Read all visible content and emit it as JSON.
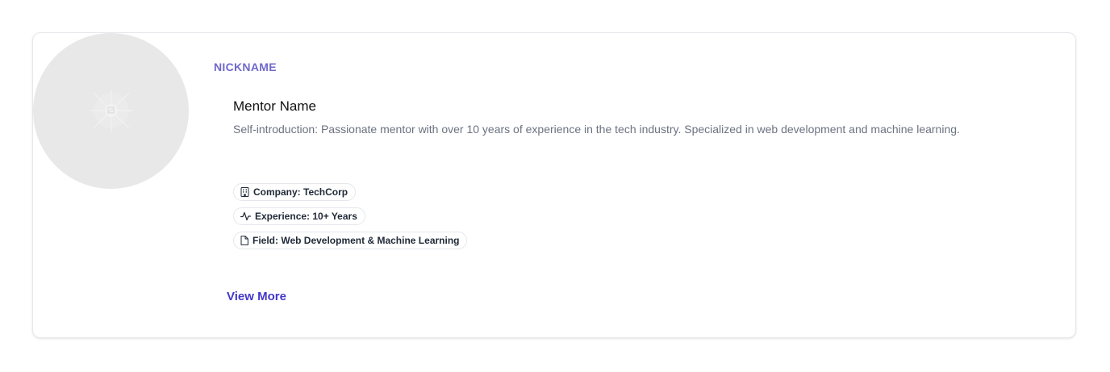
{
  "profile": {
    "nickname": "NICKNAME",
    "name": "Mentor Name",
    "introduction": "Self-introduction: Passionate mentor with over 10 years of experience in the tech industry. Specialized in web development and machine learning.",
    "avatar_icon": "image-placeholder-icon"
  },
  "tags": [
    {
      "icon": "building-icon",
      "label": "Company: TechCorp"
    },
    {
      "icon": "activity-icon",
      "label": "Experience: 10+ Years"
    },
    {
      "icon": "file-icon",
      "label": "Field: Web Development & Machine Learning"
    }
  ],
  "actions": {
    "view_more": "View More"
  },
  "colors": {
    "accent": "#7069c9",
    "link": "#4338ca",
    "muted_text": "#6b7280",
    "avatar_bg": "#e8e8e8"
  }
}
